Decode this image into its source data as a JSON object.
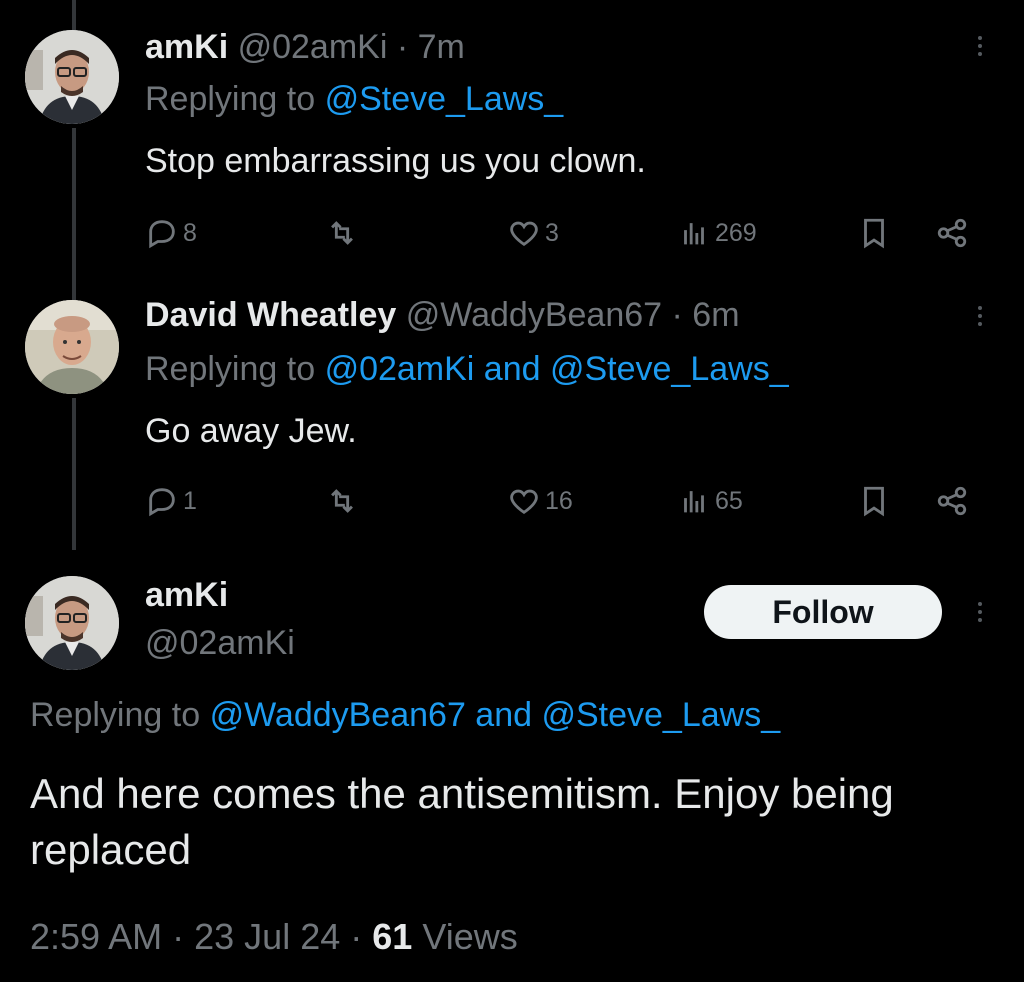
{
  "replies": [
    {
      "name": "amKi",
      "handle": "@02amKi",
      "sep": "·",
      "time": "7m",
      "replying_prefix": "Replying to",
      "replying_to": "@Steve_Laws_",
      "text": "Stop embarrassing us you clown.",
      "stats": {
        "replies": "8",
        "retweets": "",
        "likes": "3",
        "views": "269"
      },
      "avatar_icon": "avatar-glasses-man"
    },
    {
      "name": "David Wheatley",
      "handle": "@WaddyBean67",
      "sep": "·",
      "time": "6m",
      "replying_prefix": "Replying to",
      "replying_to": "@02amKi and @Steve_Laws_",
      "text": "Go away Jew.",
      "stats": {
        "replies": "1",
        "retweets": "",
        "likes": "16",
        "views": "65"
      },
      "avatar_icon": "avatar-bald-man"
    }
  ],
  "main_tweet": {
    "name": "amKi",
    "handle": "@02amKi",
    "follow_label": "Follow",
    "replying_prefix": "Replying to",
    "replying_to": "@WaddyBean67 and @Steve_Laws_",
    "text": "And here comes the antisemitism. Enjoy being replaced",
    "time": "2:59 AM",
    "date": "23 Jul 24",
    "sep": "·",
    "views_count": "61",
    "views_label": "Views"
  },
  "colors": {
    "background": "#000000",
    "text": "#e7e9ea",
    "muted": "#71767b",
    "link": "#1d9bf0",
    "follow_bg": "#eff3f4"
  }
}
